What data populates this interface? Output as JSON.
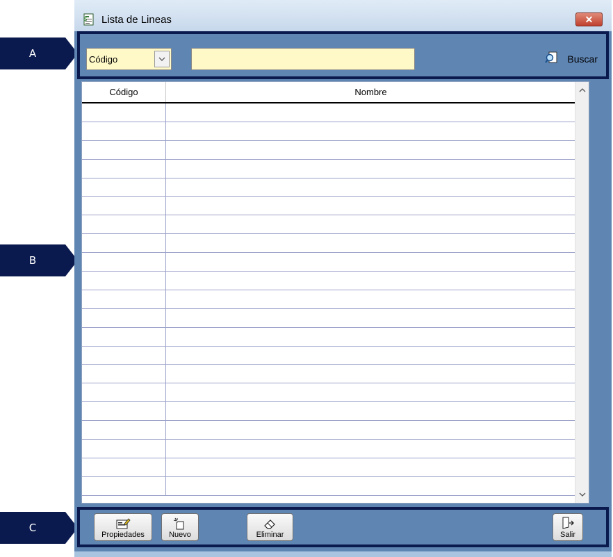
{
  "callouts": [
    "A",
    "B",
    "C"
  ],
  "window": {
    "title": "Lista de Lineas",
    "close_glyph": "✕"
  },
  "search": {
    "field_selected": "Código",
    "query_value": "",
    "query_placeholder": "",
    "search_label": "Buscar",
    "search_icon": "magnifier-icon"
  },
  "grid": {
    "columns": [
      "Código",
      "Nombre"
    ],
    "rows": [
      [
        "",
        ""
      ],
      [
        "",
        ""
      ],
      [
        "",
        ""
      ],
      [
        "",
        ""
      ],
      [
        "",
        ""
      ],
      [
        "",
        ""
      ],
      [
        "",
        ""
      ],
      [
        "",
        ""
      ],
      [
        "",
        ""
      ],
      [
        "",
        ""
      ],
      [
        "",
        ""
      ],
      [
        "",
        ""
      ],
      [
        "",
        ""
      ],
      [
        "",
        ""
      ],
      [
        "",
        ""
      ],
      [
        "",
        ""
      ],
      [
        "",
        ""
      ],
      [
        "",
        ""
      ],
      [
        "",
        ""
      ],
      [
        "",
        ""
      ],
      [
        "",
        ""
      ]
    ]
  },
  "buttons": {
    "properties": "Propiedades",
    "new": "Nuevo",
    "delete": "Eliminar",
    "exit": "Salir"
  },
  "colors": {
    "window_body": "#5f85b3",
    "callout": "#0a1a4e",
    "input_bg": "#fff9c8"
  }
}
